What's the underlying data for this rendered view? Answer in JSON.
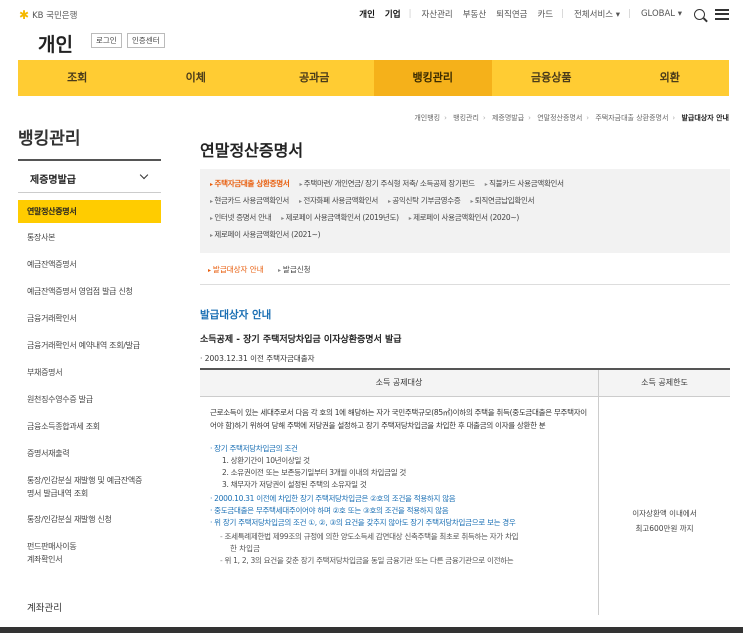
{
  "header": {
    "brand": "KB 국민은행",
    "section": "개인",
    "login": "로그인",
    "cert": "인증센터",
    "gnb": [
      "개인",
      "기업",
      "자산관리",
      "부동산",
      "퇴직연금",
      "카드",
      "전체서비스 ▾",
      "GLOBAL ▾"
    ]
  },
  "nav": [
    "조회",
    "이체",
    "공과금",
    "뱅킹관리",
    "금융상품",
    "외환"
  ],
  "sidebar": {
    "title": "뱅킹관리",
    "group": "제증명발급",
    "items": [
      "연말정산증명서",
      "통장사본",
      "예금잔액증명서",
      "예금잔액증명서 영업점 발급 신청",
      "금융거래확인서",
      "금융거래확인서 예약내역 조회/발급",
      "부채증명서",
      "원천징수영수증 발급",
      "금융소득종합과세 조회",
      "증명서재출력",
      "통장/인감분실 재발행 및 예금잔액증",
      "명서 발급내역 조회",
      "통장/인감분실 재발행 신청",
      "펀드판매사이동",
      "계좌확인서"
    ],
    "footer": "계좌관리"
  },
  "breadcrumb": [
    "개인뱅킹",
    "뱅킹관리",
    "제증명발급",
    "연말정산증명서",
    "주택자금대출 상환증명서",
    "발급대상자 안내"
  ],
  "page_title": "연말정산증명서",
  "tabs": [
    "주택자금대출 상환증명서",
    "주택마련/ 개인연금/ 장기 주식형 저축/ 소득공제 장기펀드",
    "직불카드 사용금액확인서",
    "현금카드 사용금액확인서",
    "전자화폐 사용금액확인서",
    "공익신탁 기부금영수증",
    "퇴직연금납입확인서",
    "인터넷 증명서 안내",
    "제로페이 사용금액확인서 (2019년도)",
    "제로페이 사용금액확인서 (2020~)",
    "제로페이 사용금액확인서 (2021~)"
  ],
  "subtabs": [
    "발급대상자 안내",
    "발급신청"
  ],
  "section": {
    "title": "발급대상자 안내",
    "subtitle": "소득공제 - 장기 주택저당차입금 이자상환증명서 발급",
    "note": "· 2003.12.31 이전 주택자금대출자"
  },
  "table": {
    "headers": [
      "소득 공제대상",
      "소득 공제한도"
    ],
    "intro": "근로소득이 있는 세대주로서 다음 각 호의 1에 해당하는 자가 국민주택규모(85㎡)이하의 주택을 취득(중도금대출은 무주택자이어야 함)하기 위하여 당해 주택에 저당권을 설정하고 장기 주택저당차입금을 차입한 후 대출금의 이자를 상환한 분",
    "cond_title": "장기 주택저당차입금의 조건",
    "conds": [
      "1. 상환기간이 10년이상일 것",
      "2. 소유권이전 또는 보존등기일부터 3개월 이내의 차입금일 것",
      "3. 채무자가 저당권이 설정된 주택의 소유자일 것"
    ],
    "notes": [
      "2000.10.31 이전에 차입한 장기 주택저당차입금은 ②호의 조건을 적용하지 않음",
      "중도금대출은 무주택세대주이어야 하며 ②호 또는 ③호의 조건을 적용하지 않음",
      "위 장기 주택저당차입금의 조건 ①, ②, ③의 요건을 갖추지 않아도 장기 주택저당차입금으로 보는 경우"
    ],
    "dashes": [
      "조세특례제한법 제99조의 규정에 의한 양도소득세 감면대상 신축주택을 최초로 취득하는 자가 차입",
      "한 차입금",
      "위 1, 2, 3의 요건을 갖춘 장기 주택저당차입금을 동일 금융기관 또는 다른 금융기관으로 이전하는"
    ],
    "limit": [
      "이자상환액 이내에서",
      "최고600만원 까지"
    ]
  }
}
